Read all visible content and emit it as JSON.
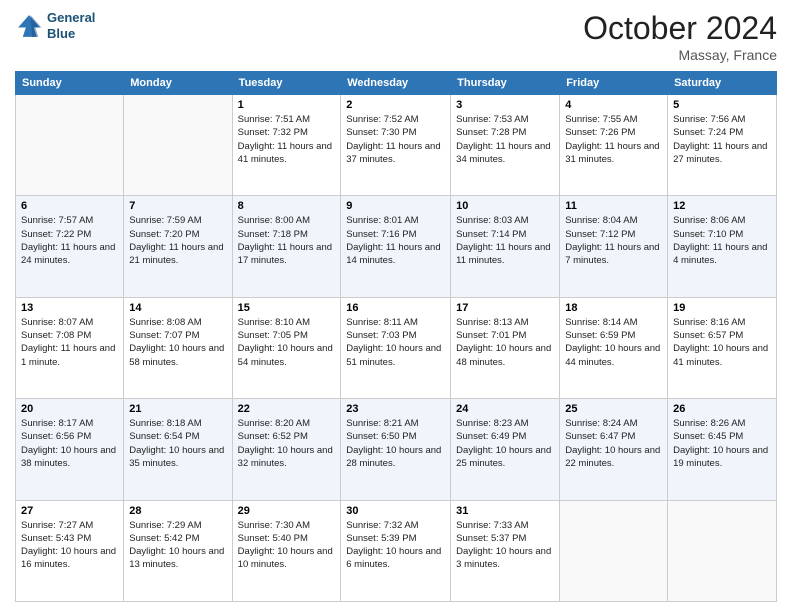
{
  "header": {
    "logo_line1": "General",
    "logo_line2": "Blue",
    "month": "October 2024",
    "location": "Massay, France"
  },
  "days_of_week": [
    "Sunday",
    "Monday",
    "Tuesday",
    "Wednesday",
    "Thursday",
    "Friday",
    "Saturday"
  ],
  "weeks": [
    [
      {
        "num": "",
        "detail": ""
      },
      {
        "num": "",
        "detail": ""
      },
      {
        "num": "1",
        "detail": "Sunrise: 7:51 AM\nSunset: 7:32 PM\nDaylight: 11 hours and 41 minutes."
      },
      {
        "num": "2",
        "detail": "Sunrise: 7:52 AM\nSunset: 7:30 PM\nDaylight: 11 hours and 37 minutes."
      },
      {
        "num": "3",
        "detail": "Sunrise: 7:53 AM\nSunset: 7:28 PM\nDaylight: 11 hours and 34 minutes."
      },
      {
        "num": "4",
        "detail": "Sunrise: 7:55 AM\nSunset: 7:26 PM\nDaylight: 11 hours and 31 minutes."
      },
      {
        "num": "5",
        "detail": "Sunrise: 7:56 AM\nSunset: 7:24 PM\nDaylight: 11 hours and 27 minutes."
      }
    ],
    [
      {
        "num": "6",
        "detail": "Sunrise: 7:57 AM\nSunset: 7:22 PM\nDaylight: 11 hours and 24 minutes."
      },
      {
        "num": "7",
        "detail": "Sunrise: 7:59 AM\nSunset: 7:20 PM\nDaylight: 11 hours and 21 minutes."
      },
      {
        "num": "8",
        "detail": "Sunrise: 8:00 AM\nSunset: 7:18 PM\nDaylight: 11 hours and 17 minutes."
      },
      {
        "num": "9",
        "detail": "Sunrise: 8:01 AM\nSunset: 7:16 PM\nDaylight: 11 hours and 14 minutes."
      },
      {
        "num": "10",
        "detail": "Sunrise: 8:03 AM\nSunset: 7:14 PM\nDaylight: 11 hours and 11 minutes."
      },
      {
        "num": "11",
        "detail": "Sunrise: 8:04 AM\nSunset: 7:12 PM\nDaylight: 11 hours and 7 minutes."
      },
      {
        "num": "12",
        "detail": "Sunrise: 8:06 AM\nSunset: 7:10 PM\nDaylight: 11 hours and 4 minutes."
      }
    ],
    [
      {
        "num": "13",
        "detail": "Sunrise: 8:07 AM\nSunset: 7:08 PM\nDaylight: 11 hours and 1 minute."
      },
      {
        "num": "14",
        "detail": "Sunrise: 8:08 AM\nSunset: 7:07 PM\nDaylight: 10 hours and 58 minutes."
      },
      {
        "num": "15",
        "detail": "Sunrise: 8:10 AM\nSunset: 7:05 PM\nDaylight: 10 hours and 54 minutes."
      },
      {
        "num": "16",
        "detail": "Sunrise: 8:11 AM\nSunset: 7:03 PM\nDaylight: 10 hours and 51 minutes."
      },
      {
        "num": "17",
        "detail": "Sunrise: 8:13 AM\nSunset: 7:01 PM\nDaylight: 10 hours and 48 minutes."
      },
      {
        "num": "18",
        "detail": "Sunrise: 8:14 AM\nSunset: 6:59 PM\nDaylight: 10 hours and 44 minutes."
      },
      {
        "num": "19",
        "detail": "Sunrise: 8:16 AM\nSunset: 6:57 PM\nDaylight: 10 hours and 41 minutes."
      }
    ],
    [
      {
        "num": "20",
        "detail": "Sunrise: 8:17 AM\nSunset: 6:56 PM\nDaylight: 10 hours and 38 minutes."
      },
      {
        "num": "21",
        "detail": "Sunrise: 8:18 AM\nSunset: 6:54 PM\nDaylight: 10 hours and 35 minutes."
      },
      {
        "num": "22",
        "detail": "Sunrise: 8:20 AM\nSunset: 6:52 PM\nDaylight: 10 hours and 32 minutes."
      },
      {
        "num": "23",
        "detail": "Sunrise: 8:21 AM\nSunset: 6:50 PM\nDaylight: 10 hours and 28 minutes."
      },
      {
        "num": "24",
        "detail": "Sunrise: 8:23 AM\nSunset: 6:49 PM\nDaylight: 10 hours and 25 minutes."
      },
      {
        "num": "25",
        "detail": "Sunrise: 8:24 AM\nSunset: 6:47 PM\nDaylight: 10 hours and 22 minutes."
      },
      {
        "num": "26",
        "detail": "Sunrise: 8:26 AM\nSunset: 6:45 PM\nDaylight: 10 hours and 19 minutes."
      }
    ],
    [
      {
        "num": "27",
        "detail": "Sunrise: 7:27 AM\nSunset: 5:43 PM\nDaylight: 10 hours and 16 minutes."
      },
      {
        "num": "28",
        "detail": "Sunrise: 7:29 AM\nSunset: 5:42 PM\nDaylight: 10 hours and 13 minutes."
      },
      {
        "num": "29",
        "detail": "Sunrise: 7:30 AM\nSunset: 5:40 PM\nDaylight: 10 hours and 10 minutes."
      },
      {
        "num": "30",
        "detail": "Sunrise: 7:32 AM\nSunset: 5:39 PM\nDaylight: 10 hours and 6 minutes."
      },
      {
        "num": "31",
        "detail": "Sunrise: 7:33 AM\nSunset: 5:37 PM\nDaylight: 10 hours and 3 minutes."
      },
      {
        "num": "",
        "detail": ""
      },
      {
        "num": "",
        "detail": ""
      }
    ]
  ]
}
